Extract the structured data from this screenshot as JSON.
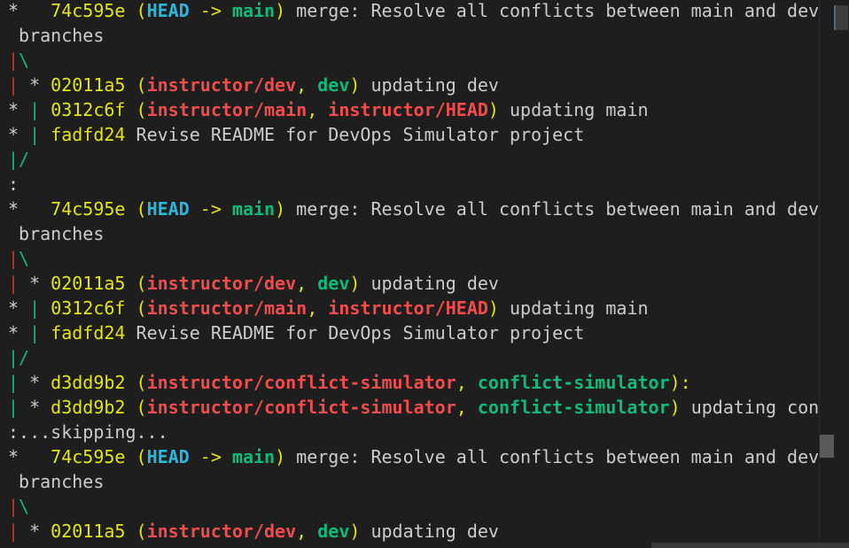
{
  "terminal": {
    "lines": [
      [
        {
          "t": "*   ",
          "c": "ast"
        },
        {
          "t": "74c595e",
          "c": "hash"
        },
        {
          "t": " (",
          "c": "paren"
        },
        {
          "t": "HEAD",
          "c": "head"
        },
        {
          "t": " -> ",
          "c": "arrow"
        },
        {
          "t": "main",
          "c": "local"
        },
        {
          "t": ")",
          "c": "paren"
        },
        {
          "t": " merge: Resolve all conflicts between main and dev",
          "c": "msg"
        }
      ],
      [
        {
          "t": " branches",
          "c": "msg"
        }
      ],
      [
        {
          "t": "|",
          "c": "g-red"
        },
        {
          "t": "\\",
          "c": "g-green"
        }
      ],
      [
        {
          "t": "|",
          "c": "g-red"
        },
        {
          "t": " * ",
          "c": "ast"
        },
        {
          "t": "02011a5",
          "c": "hash"
        },
        {
          "t": " (",
          "c": "paren"
        },
        {
          "t": "instructor/dev",
          "c": "remote"
        },
        {
          "t": ", ",
          "c": "paren"
        },
        {
          "t": "dev",
          "c": "local"
        },
        {
          "t": ")",
          "c": "paren"
        },
        {
          "t": " updating dev",
          "c": "msg"
        }
      ],
      [
        {
          "t": "* ",
          "c": "ast"
        },
        {
          "t": "|",
          "c": "g-green"
        },
        {
          "t": " ",
          "c": "ast"
        },
        {
          "t": "0312c6f",
          "c": "hash"
        },
        {
          "t": " (",
          "c": "paren"
        },
        {
          "t": "instructor/main",
          "c": "remote"
        },
        {
          "t": ", ",
          "c": "paren"
        },
        {
          "t": "instructor/HEAD",
          "c": "remote"
        },
        {
          "t": ")",
          "c": "paren"
        },
        {
          "t": " updating main",
          "c": "msg"
        }
      ],
      [
        {
          "t": "* ",
          "c": "ast"
        },
        {
          "t": "|",
          "c": "g-green"
        },
        {
          "t": " ",
          "c": "ast"
        },
        {
          "t": "fadfd24",
          "c": "hash"
        },
        {
          "t": " Revise README for DevOps Simulator project",
          "c": "msg"
        }
      ],
      [
        {
          "t": "|/",
          "c": "g-green"
        }
      ],
      [
        {
          "t": ":",
          "c": "msg"
        }
      ],
      [
        {
          "t": "*   ",
          "c": "ast"
        },
        {
          "t": "74c595e",
          "c": "hash"
        },
        {
          "t": " (",
          "c": "paren"
        },
        {
          "t": "HEAD",
          "c": "head"
        },
        {
          "t": " -> ",
          "c": "arrow"
        },
        {
          "t": "main",
          "c": "local"
        },
        {
          "t": ")",
          "c": "paren"
        },
        {
          "t": " merge: Resolve all conflicts between main and dev",
          "c": "msg"
        }
      ],
      [
        {
          "t": " branches",
          "c": "msg"
        }
      ],
      [
        {
          "t": "|",
          "c": "g-red"
        },
        {
          "t": "\\",
          "c": "g-green"
        }
      ],
      [
        {
          "t": "|",
          "c": "g-red"
        },
        {
          "t": " * ",
          "c": "ast"
        },
        {
          "t": "02011a5",
          "c": "hash"
        },
        {
          "t": " (",
          "c": "paren"
        },
        {
          "t": "instructor/dev",
          "c": "remote"
        },
        {
          "t": ", ",
          "c": "paren"
        },
        {
          "t": "dev",
          "c": "local"
        },
        {
          "t": ")",
          "c": "paren"
        },
        {
          "t": " updating dev",
          "c": "msg"
        }
      ],
      [
        {
          "t": "* ",
          "c": "ast"
        },
        {
          "t": "|",
          "c": "g-green"
        },
        {
          "t": " ",
          "c": "ast"
        },
        {
          "t": "0312c6f",
          "c": "hash"
        },
        {
          "t": " (",
          "c": "paren"
        },
        {
          "t": "instructor/main",
          "c": "remote"
        },
        {
          "t": ", ",
          "c": "paren"
        },
        {
          "t": "instructor/HEAD",
          "c": "remote"
        },
        {
          "t": ")",
          "c": "paren"
        },
        {
          "t": " updating main",
          "c": "msg"
        }
      ],
      [
        {
          "t": "* ",
          "c": "ast"
        },
        {
          "t": "|",
          "c": "g-green"
        },
        {
          "t": " ",
          "c": "ast"
        },
        {
          "t": "fadfd24",
          "c": "hash"
        },
        {
          "t": " Revise README for DevOps Simulator project",
          "c": "msg"
        }
      ],
      [
        {
          "t": "|/",
          "c": "g-green"
        }
      ],
      [
        {
          "t": "|",
          "c": "g-green"
        },
        {
          "t": " * ",
          "c": "ast"
        },
        {
          "t": "d3dd9b2",
          "c": "hash"
        },
        {
          "t": " (",
          "c": "paren"
        },
        {
          "t": "instructor/conflict-simulator",
          "c": "remote"
        },
        {
          "t": ", ",
          "c": "paren"
        },
        {
          "t": "conflict-simulator",
          "c": "local"
        },
        {
          "t": "):",
          "c": "paren"
        }
      ],
      [
        {
          "t": "|",
          "c": "g-green"
        },
        {
          "t": " * ",
          "c": "ast"
        },
        {
          "t": "d3dd9b2",
          "c": "hash"
        },
        {
          "t": " (",
          "c": "paren"
        },
        {
          "t": "instructor/conflict-simulator",
          "c": "remote"
        },
        {
          "t": ", ",
          "c": "paren"
        },
        {
          "t": "conflict-simulator",
          "c": "local"
        },
        {
          "t": ")",
          "c": "paren"
        },
        {
          "t": " updating con",
          "c": "msg"
        }
      ],
      [
        {
          "t": ":...skipping...",
          "c": "msg"
        }
      ],
      [
        {
          "t": "*   ",
          "c": "ast"
        },
        {
          "t": "74c595e",
          "c": "hash"
        },
        {
          "t": " (",
          "c": "paren"
        },
        {
          "t": "HEAD",
          "c": "head"
        },
        {
          "t": " -> ",
          "c": "arrow"
        },
        {
          "t": "main",
          "c": "local"
        },
        {
          "t": ")",
          "c": "paren"
        },
        {
          "t": " merge: Resolve all conflicts between main and dev",
          "c": "msg"
        }
      ],
      [
        {
          "t": " branches",
          "c": "msg"
        }
      ],
      [
        {
          "t": "|",
          "c": "g-red"
        },
        {
          "t": "\\",
          "c": "g-green"
        }
      ],
      [
        {
          "t": "|",
          "c": "g-red"
        },
        {
          "t": " * ",
          "c": "ast"
        },
        {
          "t": "02011a5",
          "c": "hash"
        },
        {
          "t": " (",
          "c": "paren"
        },
        {
          "t": "instructor/dev",
          "c": "remote"
        },
        {
          "t": ", ",
          "c": "paren"
        },
        {
          "t": "dev",
          "c": "local"
        },
        {
          "t": ")",
          "c": "paren"
        },
        {
          "t": " updating dev",
          "c": "msg"
        }
      ]
    ]
  },
  "colors": {
    "background": "#1e1e1e",
    "hash": "#e5e510",
    "head": "#29b8db",
    "local_branch": "#0dbc79",
    "remote_branch": "#f14c4c",
    "graph_red": "#cd3131",
    "text": "#cccccc"
  }
}
